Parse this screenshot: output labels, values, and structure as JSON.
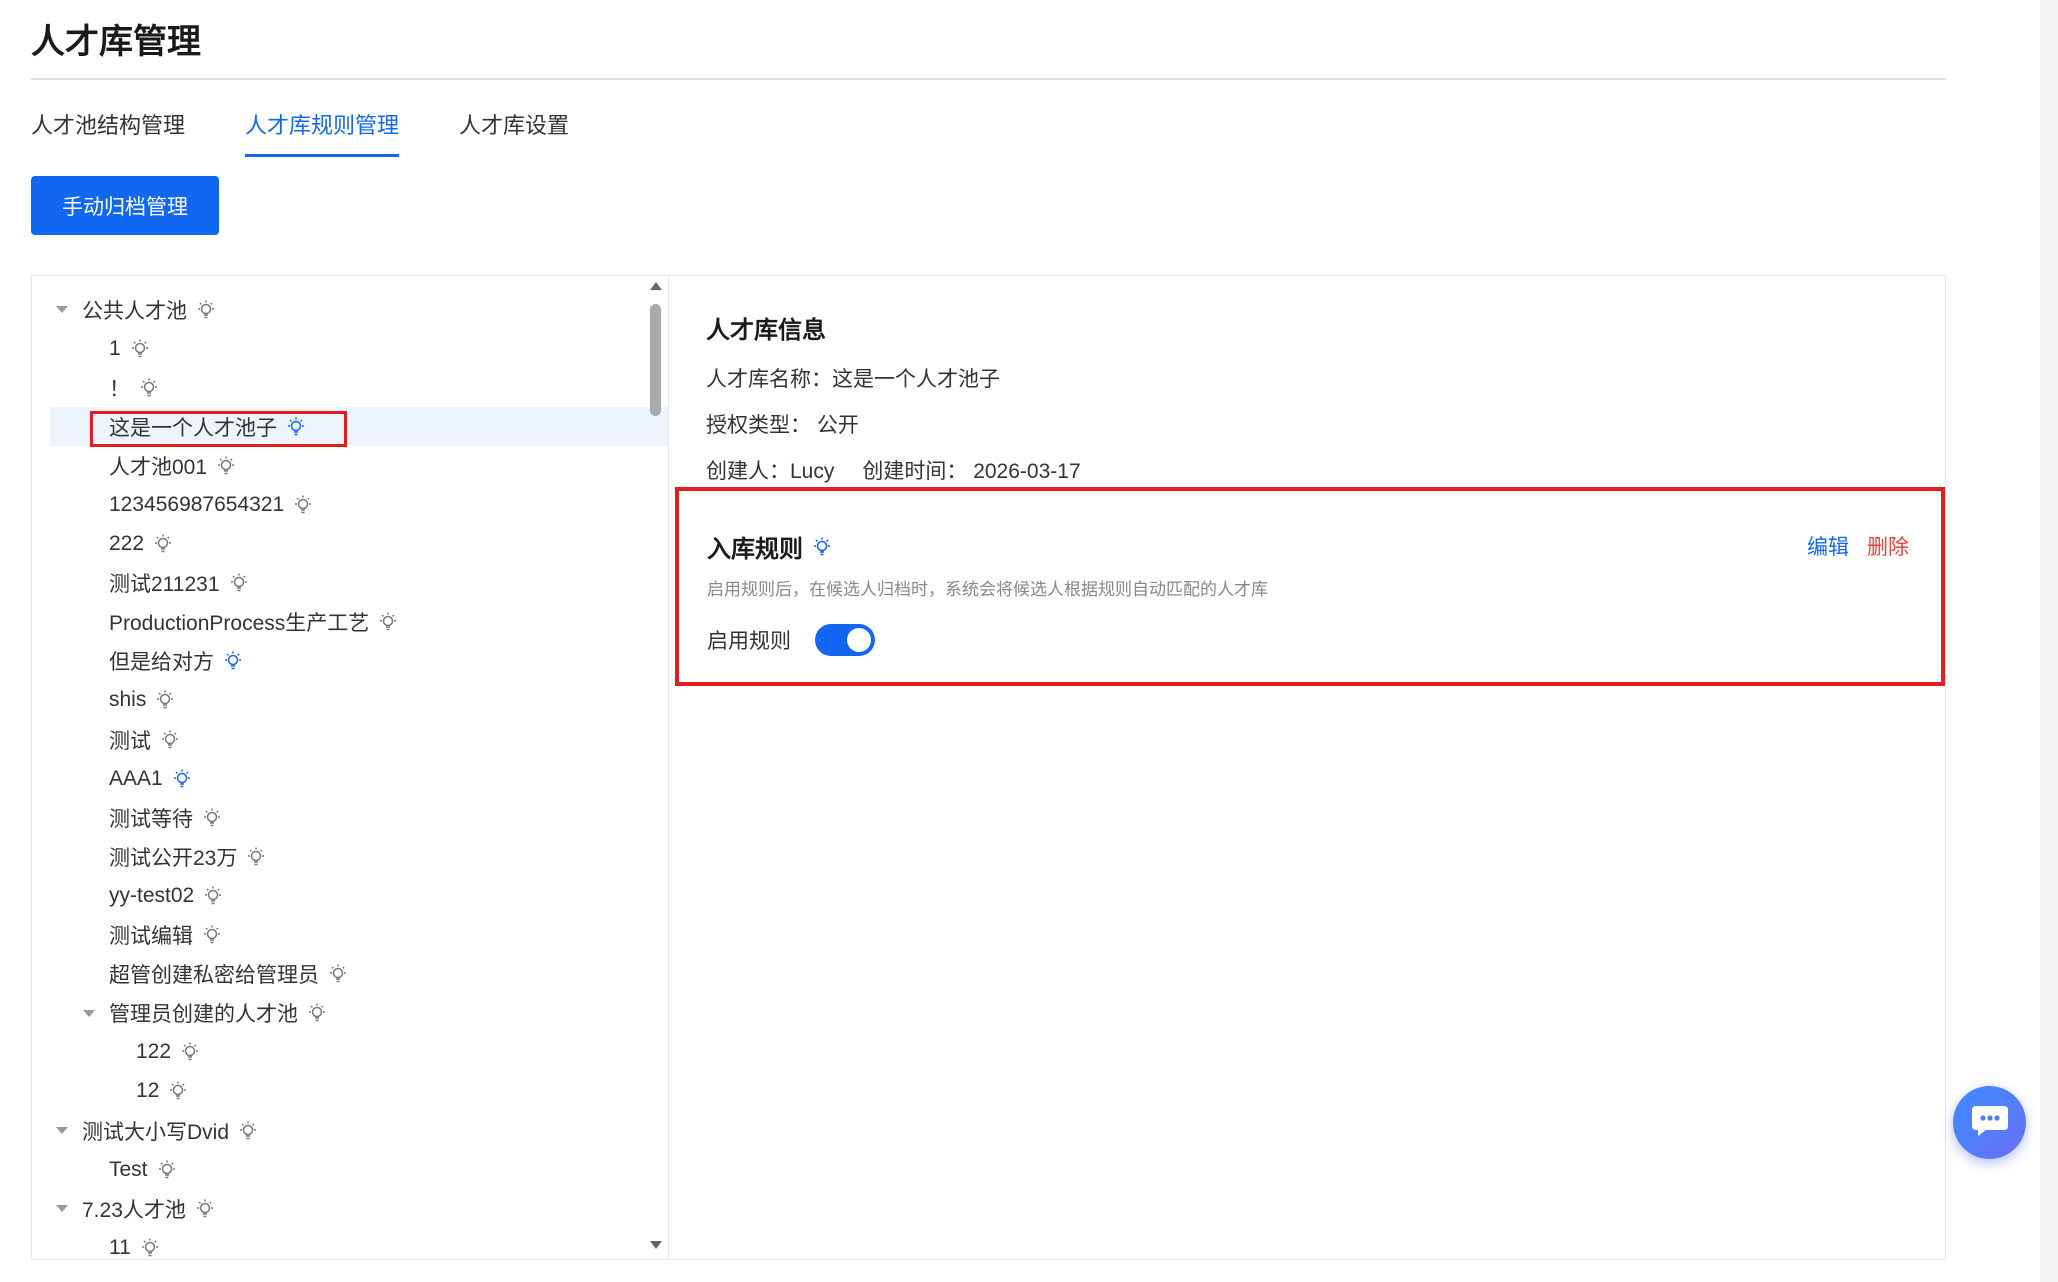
{
  "page": {
    "title": "人才库管理"
  },
  "tabs": [
    {
      "label": "人才池结构管理",
      "active": false
    },
    {
      "label": "人才库规则管理",
      "active": true
    },
    {
      "label": "人才库设置",
      "active": false
    }
  ],
  "toolbar": {
    "archive_label": "手动归档管理"
  },
  "tree": [
    {
      "label": "公共人才池",
      "level": 0,
      "caret": true,
      "rule": false
    },
    {
      "label": "1",
      "level": 1,
      "caret": false,
      "rule": false
    },
    {
      "label": "！",
      "level": 1,
      "caret": false,
      "rule": false
    },
    {
      "label": "这是一个人才池子",
      "level": 1,
      "caret": false,
      "rule": true,
      "selected": true
    },
    {
      "label": "人才池001",
      "level": 1,
      "caret": false,
      "rule": false
    },
    {
      "label": "123456987654321",
      "level": 1,
      "caret": false,
      "rule": false
    },
    {
      "label": "222",
      "level": 1,
      "caret": false,
      "rule": false
    },
    {
      "label": "测试211231",
      "level": 1,
      "caret": false,
      "rule": false
    },
    {
      "label": "ProductionProcess生产工艺",
      "level": 1,
      "caret": false,
      "rule": false
    },
    {
      "label": "但是给对方",
      "level": 1,
      "caret": false,
      "rule": true
    },
    {
      "label": "shis",
      "level": 1,
      "caret": false,
      "rule": false
    },
    {
      "label": "测试",
      "level": 1,
      "caret": false,
      "rule": false
    },
    {
      "label": "AAA1",
      "level": 1,
      "caret": false,
      "rule": true
    },
    {
      "label": "测试等待",
      "level": 1,
      "caret": false,
      "rule": false
    },
    {
      "label": "测试公开23万",
      "level": 1,
      "caret": false,
      "rule": false
    },
    {
      "label": "yy-test02",
      "level": 1,
      "caret": false,
      "rule": false
    },
    {
      "label": "测试编辑",
      "level": 1,
      "caret": false,
      "rule": false
    },
    {
      "label": "超管创建私密给管理员",
      "level": 1,
      "caret": false,
      "rule": false
    },
    {
      "label": "管理员创建的人才池",
      "level": 1,
      "caret": true,
      "rule": false
    },
    {
      "label": "122",
      "level": 2,
      "caret": false,
      "rule": false
    },
    {
      "label": "12",
      "level": 2,
      "caret": false,
      "rule": false
    },
    {
      "label": "测试大小写Dvid",
      "level": 0,
      "caret": true,
      "rule": false
    },
    {
      "label": "Test",
      "level": 1,
      "caret": false,
      "rule": false
    },
    {
      "label": "7.23人才池",
      "level": 0,
      "caret": true,
      "rule": false
    },
    {
      "label": "11",
      "level": 1,
      "caret": false,
      "rule": false
    }
  ],
  "info": {
    "title": "人才库信息",
    "name_label": "人才库名称：",
    "name_value": "这是一个人才池子",
    "auth_label": "授权类型：",
    "auth_value": "公开",
    "creator_label": "创建人：",
    "creator_value": "Lucy",
    "created_label": "创建时间：",
    "created_value": "2026-03-17"
  },
  "rule": {
    "title": "入库规则",
    "description": "启用规则后，在候选人归档时，系统会将候选人根据规则自动匹配的人才库",
    "edit_label": "编辑",
    "delete_label": "删除",
    "enable_label": "启用规则",
    "enabled": true
  },
  "colors": {
    "accent": "#1167f2",
    "danger": "#e8443a",
    "highlight": "#e02020"
  },
  "icons": {
    "rule": "lightbulb-icon",
    "chat": "chat-icon"
  }
}
